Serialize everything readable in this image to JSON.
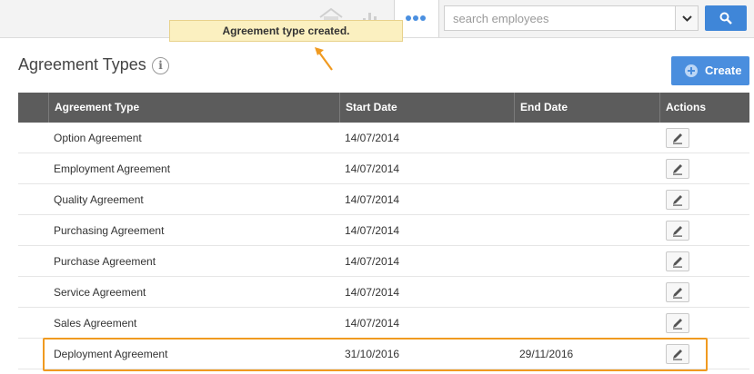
{
  "header": {
    "search_placeholder": "search employees"
  },
  "toast": {
    "message": "Agreement type created."
  },
  "page": {
    "title": "Agreement Types",
    "info_glyph": "i",
    "create_label": "Create"
  },
  "table": {
    "columns": [
      "Agreement Type",
      "Start Date",
      "End Date",
      "Actions"
    ],
    "rows": [
      {
        "type": "Option Agreement",
        "start": "14/07/2014",
        "end": ""
      },
      {
        "type": "Employment Agreement",
        "start": "14/07/2014",
        "end": ""
      },
      {
        "type": "Quality Agreement",
        "start": "14/07/2014",
        "end": ""
      },
      {
        "type": "Purchasing Agreement",
        "start": "14/07/2014",
        "end": ""
      },
      {
        "type": "Purchase Agreement",
        "start": "14/07/2014",
        "end": ""
      },
      {
        "type": "Service Agreement",
        "start": "14/07/2014",
        "end": ""
      },
      {
        "type": "Sales Agreement",
        "start": "14/07/2014",
        "end": ""
      },
      {
        "type": "Deployment Agreement",
        "start": "31/10/2016",
        "end": "29/11/2016"
      }
    ]
  },
  "icons": {
    "home": "home-icon",
    "chart": "bar-chart-icon",
    "more": "more-dots-icon",
    "dropdown": "chevron-down-icon",
    "search": "search-icon",
    "info": "info-icon",
    "add": "plus-circle-icon",
    "edit": "pencil-icon",
    "annotation": "arrow-icon"
  },
  "colors": {
    "accent": "#4a8ede",
    "header_bg": "#5c5c5c",
    "toast_bg": "#fbf0c0",
    "highlight": "#f09a20"
  }
}
